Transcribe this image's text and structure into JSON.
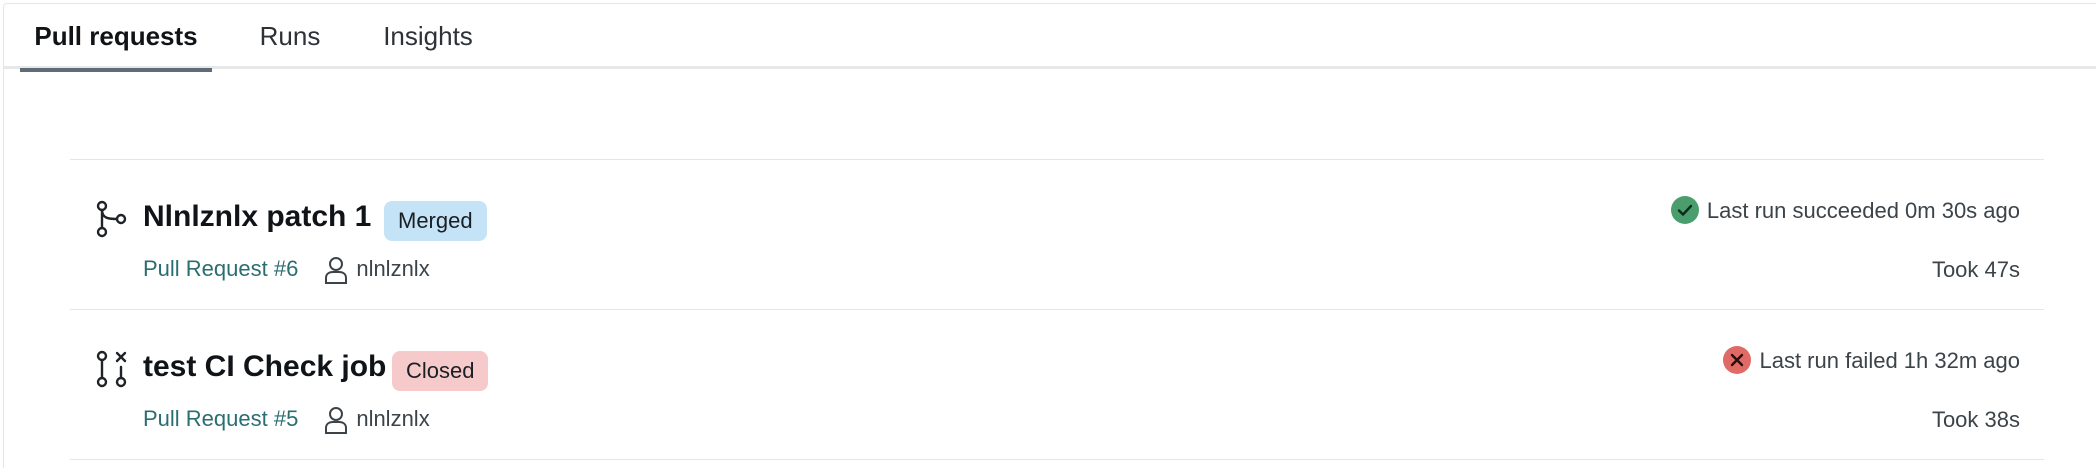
{
  "tabs": [
    {
      "label": "Pull requests",
      "active": true
    },
    {
      "label": "Runs",
      "active": false
    },
    {
      "label": "Insights",
      "active": false
    }
  ],
  "pull_requests": [
    {
      "title": "Nlnlznlx patch 1",
      "state": "Merged",
      "state_icon": "git-merge-icon",
      "pr_label": "Pull Request #6",
      "author": "nlnlznlx",
      "status_icon": "check-circle-icon",
      "status_text": "Last run succeeded 0m 30s ago",
      "status_color": "#4a9e6e",
      "duration": "Took 47s"
    },
    {
      "title": "test CI Check job",
      "state": "Closed",
      "state_icon": "git-pull-request-closed-icon",
      "pr_label": "Pull Request #5",
      "author": "nlnlznlx",
      "status_icon": "x-circle-icon",
      "status_text": "Last run failed 1h 32m ago",
      "status_color": "#e06b66",
      "duration": "Took 38s"
    }
  ],
  "colors": {
    "merged_badge": "#c5e3f6",
    "closed_badge": "#f6caca",
    "link": "#2a6e72"
  }
}
